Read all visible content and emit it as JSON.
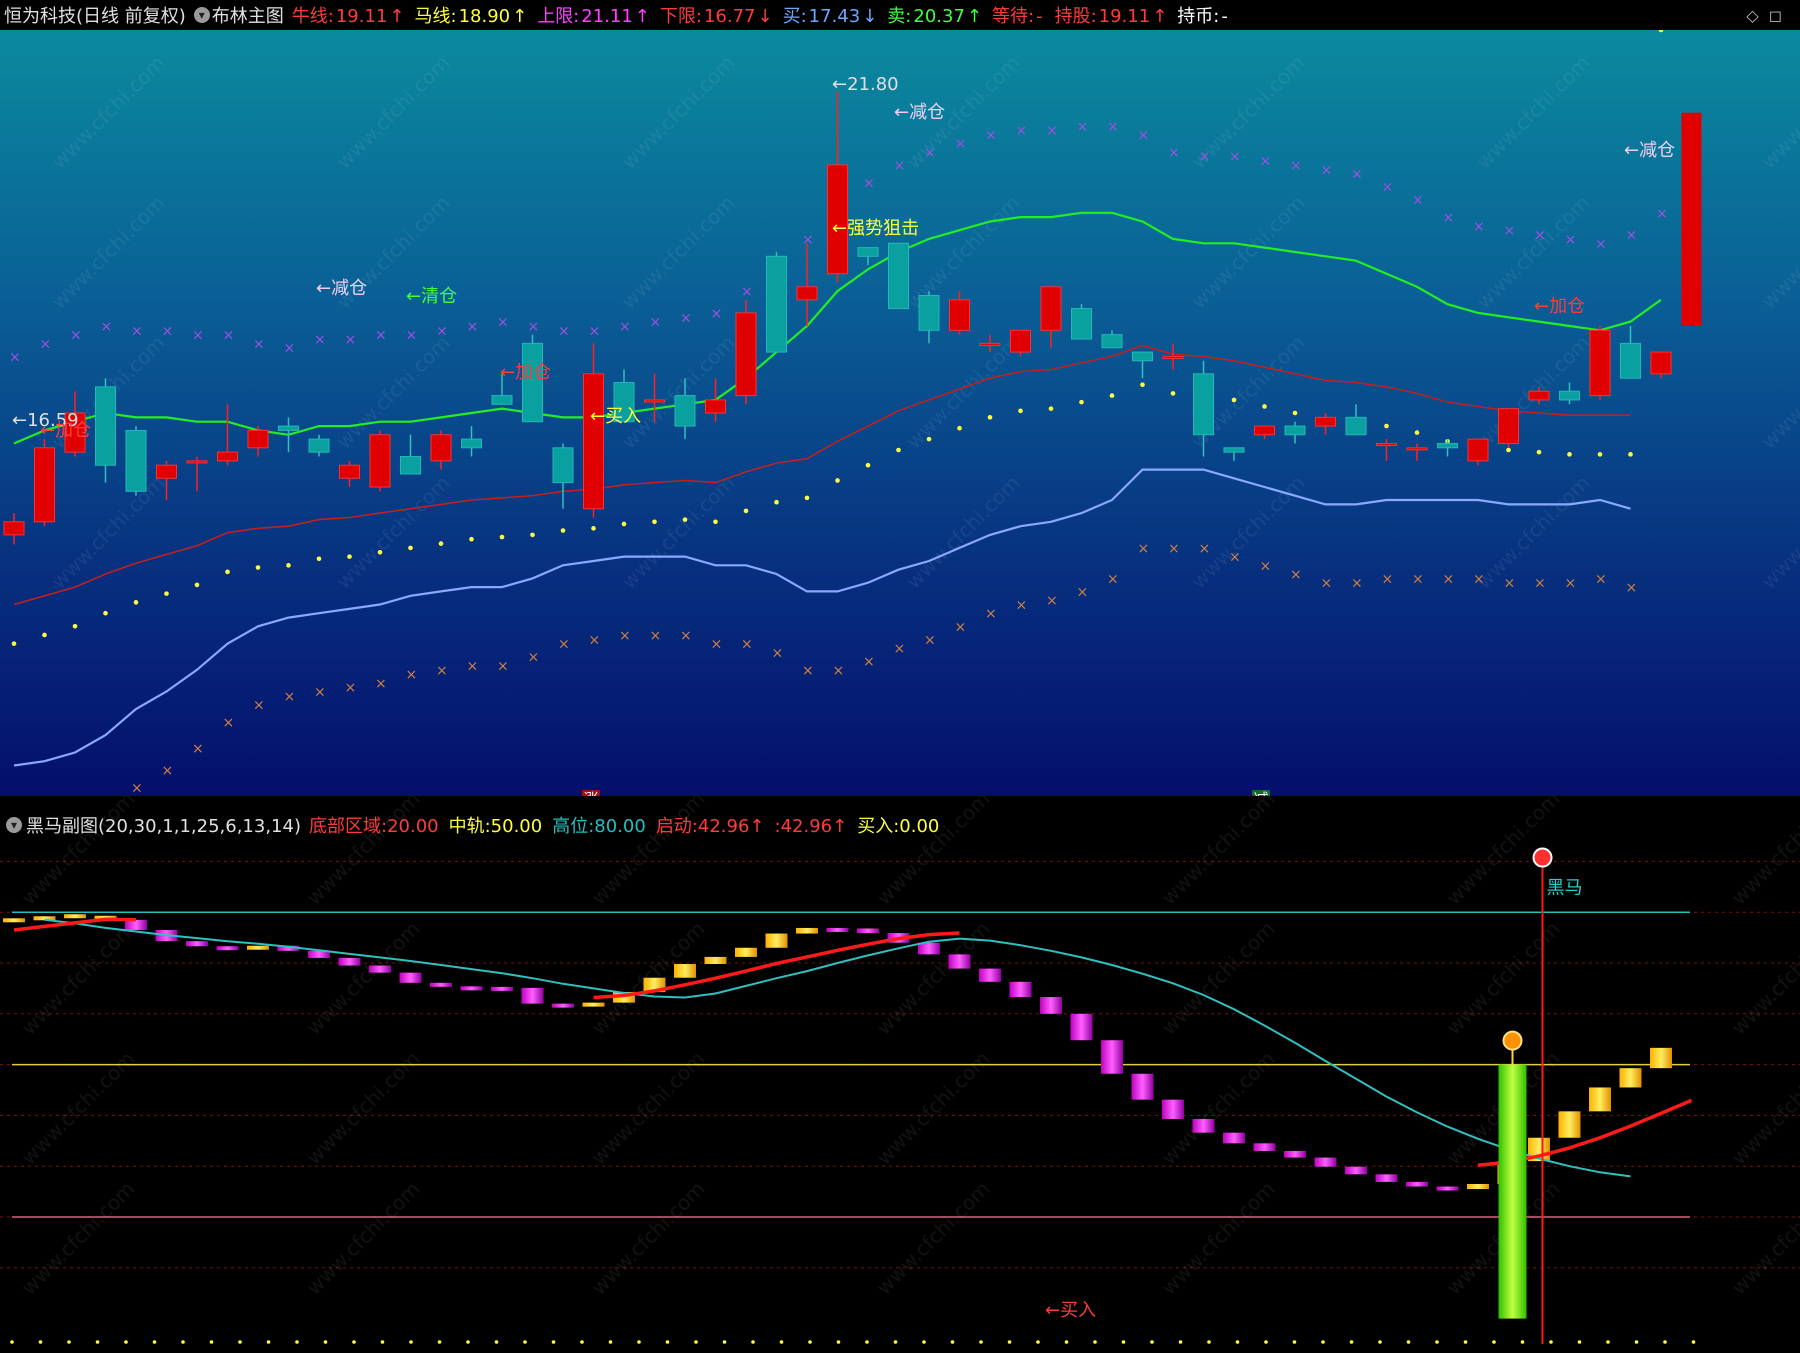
{
  "header": {
    "stock": "恒为科技(日线 前复权)",
    "indicator": "布林主图",
    "items": [
      {
        "label": "牛线:",
        "value": "19.11",
        "arrow": "↑",
        "label_color": "#ff3b3b",
        "value_color": "#ff3b3b"
      },
      {
        "label": "马线:",
        "value": "18.90",
        "arrow": "↑",
        "label_color": "#ffff40",
        "value_color": "#ffff40"
      },
      {
        "label": "上限:",
        "value": "21.11",
        "arrow": "↑",
        "label_color": "#ff40ff",
        "value_color": "#ff40ff"
      },
      {
        "label": "下限:",
        "value": "16.77",
        "arrow": "↓",
        "label_color": "#ff3b3b",
        "value_color": "#ff3b3b"
      },
      {
        "label": "买:",
        "value": "17.43",
        "arrow": "↓",
        "label_color": "#6aa8ff",
        "value_color": "#6aa8ff"
      },
      {
        "label": "卖:",
        "value": "20.37",
        "arrow": "↑",
        "label_color": "#40ff40",
        "value_color": "#40ff40"
      },
      {
        "label": "等待:",
        "value": "-",
        "arrow": "",
        "label_color": "#ff3b3b",
        "value_color": "#ff3b3b"
      },
      {
        "label": "持股:",
        "value": "19.11",
        "arrow": "↑",
        "label_color": "#ff3b3b",
        "value_color": "#ff3b3b"
      },
      {
        "label": "持币:",
        "value": "-",
        "arrow": "",
        "label_color": "#ffffff",
        "value_color": "#ffffff"
      }
    ]
  },
  "divider": {
    "rise_label": "涨",
    "cut_label": "减"
  },
  "sub_header": {
    "name": "黑马副图(20,30,1,1,25,6,13,14)",
    "items": [
      {
        "label": "底部区域:",
        "value": "20.00",
        "arrow": "",
        "color": "#ff3b3b"
      },
      {
        "label": "中轨:",
        "value": "50.00",
        "arrow": "",
        "color": "#ffff40"
      },
      {
        "label": "高位:",
        "value": "80.00",
        "arrow": "",
        "color": "#20c0c0"
      },
      {
        "label": "启动:",
        "value": "42.96",
        "arrow": "↑",
        "color": "#ff3b3b"
      },
      {
        "label": ":",
        "value": "42.96",
        "arrow": "↑",
        "color": "#ff3b3b"
      },
      {
        "label": "买入:",
        "value": "0.00",
        "arrow": "",
        "color": "#ffff40"
      }
    ]
  },
  "annotations_main": [
    {
      "text": "←16.59",
      "color": "#e0e0e0"
    },
    {
      "text": "←加仓",
      "color": "#ff3b3b"
    },
    {
      "text": "←减仓",
      "color": "#f0d0f0"
    },
    {
      "text": "←清仓",
      "color": "#40ff40"
    },
    {
      "text": "←加仓",
      "color": "#ff3b3b"
    },
    {
      "text": "←买入",
      "color": "#ffff40"
    },
    {
      "text": "←21.80",
      "color": "#e0e0e0"
    },
    {
      "text": "←减仓",
      "color": "#f0d0f0"
    },
    {
      "text": "←强势狙击",
      "color": "#ffff40"
    },
    {
      "text": "←加仓",
      "color": "#ff3b3b"
    },
    {
      "text": "←减仓",
      "color": "#f0d0f0"
    }
  ],
  "annotations_sub": [
    {
      "text": "黑马",
      "color": "#20d0d0"
    },
    {
      "text": "←买入",
      "color": "#ff3b3b"
    }
  ],
  "chart_data": [
    {
      "type": "candlestick",
      "title": "布林主图",
      "x": [
        1,
        2,
        3,
        4,
        5,
        6,
        7,
        8,
        9,
        10,
        11,
        12,
        13,
        14,
        15,
        16,
        17,
        18,
        19,
        20,
        21,
        22,
        23,
        24,
        25,
        26,
        27,
        28,
        29,
        30,
        31,
        32,
        33,
        34,
        35,
        36,
        37,
        38,
        39,
        40,
        41,
        42,
        43,
        44,
        45,
        46,
        47,
        48,
        49,
        50,
        51,
        52,
        53,
        54,
        55
      ],
      "ohlc": [
        [
          16.7,
          16.95,
          16.59,
          16.85
        ],
        [
          16.85,
          17.8,
          16.8,
          17.7
        ],
        [
          17.65,
          18.35,
          17.6,
          18.1
        ],
        [
          18.4,
          18.5,
          17.3,
          17.5
        ],
        [
          17.9,
          17.95,
          17.15,
          17.2
        ],
        [
          17.35,
          17.55,
          17.1,
          17.5
        ],
        [
          17.55,
          17.6,
          17.2,
          17.55
        ],
        [
          17.55,
          18.2,
          17.5,
          17.65
        ],
        [
          17.7,
          17.95,
          17.6,
          17.9
        ],
        [
          17.95,
          18.05,
          17.65,
          17.9
        ],
        [
          17.8,
          17.85,
          17.6,
          17.65
        ],
        [
          17.35,
          17.55,
          17.25,
          17.5
        ],
        [
          17.25,
          17.9,
          17.2,
          17.85
        ],
        [
          17.6,
          17.85,
          17.4,
          17.4
        ],
        [
          17.55,
          17.9,
          17.45,
          17.85
        ],
        [
          17.8,
          17.95,
          17.6,
          17.7
        ],
        [
          18.3,
          18.55,
          18.3,
          18.2
        ],
        [
          18.9,
          19.0,
          18.0,
          18.0
        ],
        [
          17.7,
          17.75,
          17.0,
          17.3
        ],
        [
          17.0,
          18.9,
          16.9,
          18.55
        ],
        [
          18.45,
          18.6,
          18.0,
          18.0
        ],
        [
          18.25,
          18.55,
          18.0,
          18.25
        ],
        [
          18.3,
          18.5,
          17.8,
          17.95
        ],
        [
          18.1,
          18.5,
          18.0,
          18.25
        ],
        [
          18.3,
          19.4,
          18.2,
          19.25
        ],
        [
          19.9,
          19.95,
          18.8,
          18.8
        ],
        [
          19.4,
          20.05,
          19.1,
          19.55
        ],
        [
          19.7,
          21.8,
          19.6,
          20.95
        ],
        [
          20.0,
          20.0,
          19.8,
          19.9
        ],
        [
          20.05,
          20.05,
          19.3,
          19.3
        ],
        [
          19.45,
          19.5,
          18.9,
          19.05
        ],
        [
          19.05,
          19.5,
          19.0,
          19.4
        ],
        [
          18.9,
          19.0,
          18.8,
          18.9
        ],
        [
          18.8,
          19.0,
          18.75,
          19.05
        ],
        [
          19.05,
          19.55,
          18.85,
          19.55
        ],
        [
          19.3,
          19.35,
          18.95,
          18.95
        ],
        [
          19.0,
          19.05,
          18.85,
          18.85
        ],
        [
          18.8,
          18.8,
          18.5,
          18.7
        ],
        [
          18.75,
          18.9,
          18.6,
          18.75
        ],
        [
          18.55,
          18.7,
          17.6,
          17.85
        ],
        [
          17.7,
          17.7,
          17.55,
          17.65
        ],
        [
          17.85,
          17.95,
          17.8,
          17.95
        ],
        [
          17.95,
          18.0,
          17.75,
          17.85
        ],
        [
          17.95,
          18.1,
          17.85,
          18.05
        ],
        [
          18.05,
          18.2,
          17.95,
          17.85
        ],
        [
          17.75,
          17.8,
          17.55,
          17.75
        ],
        [
          17.7,
          17.75,
          17.55,
          17.7
        ],
        [
          17.75,
          17.8,
          17.6,
          17.7
        ],
        [
          17.55,
          17.8,
          17.5,
          17.8
        ],
        [
          17.75,
          18.1,
          17.7,
          18.15
        ],
        [
          18.25,
          18.4,
          18.2,
          18.35
        ],
        [
          18.35,
          18.45,
          18.2,
          18.25
        ],
        [
          18.3,
          19.1,
          18.25,
          19.05
        ],
        [
          18.9,
          19.1,
          18.5,
          18.5
        ],
        [
          18.55,
          18.8,
          18.5,
          18.8
        ]
      ],
      "last_close": 20.25,
      "upper_band": [
        17.75,
        17.9,
        18.0,
        18.1,
        18.05,
        18.05,
        18.0,
        18.0,
        17.9,
        17.85,
        17.95,
        17.95,
        18.0,
        18.0,
        18.05,
        18.1,
        18.15,
        18.1,
        18.05,
        18.05,
        18.1,
        18.15,
        18.2,
        18.25,
        18.5,
        18.8,
        19.1,
        19.5,
        19.75,
        19.95,
        20.1,
        20.2,
        20.3,
        20.35,
        20.35,
        20.4,
        20.4,
        20.3,
        20.1,
        20.05,
        20.05,
        20.0,
        19.95,
        19.9,
        19.85,
        19.7,
        19.55,
        19.35,
        19.25,
        19.2,
        19.15,
        19.1,
        19.05,
        19.15,
        19.4
      ],
      "lower_band": [
        14.05,
        14.1,
        14.2,
        14.4,
        14.7,
        14.9,
        15.15,
        15.45,
        15.65,
        15.75,
        15.8,
        15.85,
        15.9,
        16.0,
        16.05,
        16.1,
        16.1,
        16.2,
        16.35,
        16.4,
        16.45,
        16.45,
        16.45,
        16.35,
        16.35,
        16.25,
        16.05,
        16.05,
        16.15,
        16.3,
        16.4,
        16.55,
        16.7,
        16.8,
        16.85,
        16.95,
        17.1,
        17.45,
        17.45,
        17.45,
        17.35,
        17.25,
        17.15,
        17.05,
        17.05,
        17.1,
        17.1,
        17.1,
        17.1,
        17.05,
        17.05,
        17.05,
        17.1,
        17.0
      ],
      "ylim": [
        13.7,
        22.5
      ]
    },
    {
      "type": "bar-line",
      "title": "黑马副图",
      "reference_lines": {
        "底部区域": 20,
        "中轨": 50,
        "高位": 80
      },
      "grid": "dotted",
      "x": [
        1,
        2,
        3,
        4,
        5,
        6,
        7,
        8,
        9,
        10,
        11,
        12,
        13,
        14,
        15,
        16,
        17,
        18,
        19,
        20,
        21,
        22,
        23,
        24,
        25,
        26,
        27,
        28,
        29,
        30,
        31,
        32,
        33,
        34,
        35,
        36,
        37,
        38,
        39,
        40,
        41,
        42,
        43,
        44,
        45,
        46,
        47,
        48,
        49,
        50,
        51,
        52,
        53,
        54,
        55
      ],
      "bars_open": [
        78.5,
        78.8,
        79.2,
        79.3,
        78.5,
        76.5,
        74.3,
        73.3,
        73.1,
        73.4,
        72.4,
        71.0,
        69.5,
        68.1,
        66.1,
        65.4,
        65.3,
        65.1,
        62.0,
        61.5,
        62.2,
        64.3,
        67.1,
        69.8,
        71.2,
        73.0,
        75.8,
        76.9,
        76.8,
        75.9,
        74.0,
        71.7,
        68.9,
        66.3,
        63.3,
        60.0,
        54.8,
        48.2,
        43.1,
        39.3,
        36.6,
        34.5,
        33.0,
        31.7,
        29.9,
        28.4,
        26.9,
        26.0,
        25.5,
        26.5,
        31.0,
        35.6,
        40.8,
        45.5,
        49.3
      ],
      "bars_close": [
        78.8,
        79.2,
        79.6,
        79.3,
        76.5,
        74.3,
        73.3,
        73.1,
        73.4,
        72.4,
        71.0,
        69.5,
        68.1,
        66.1,
        65.4,
        65.3,
        65.1,
        62.0,
        61.5,
        62.2,
        64.3,
        67.1,
        69.8,
        71.2,
        73.0,
        75.8,
        76.9,
        76.8,
        75.9,
        74.0,
        71.7,
        68.9,
        66.3,
        63.3,
        60.0,
        54.8,
        48.2,
        43.1,
        39.3,
        36.6,
        34.5,
        33.0,
        31.7,
        29.9,
        28.4,
        26.9,
        26.0,
        25.5,
        26.5,
        31.0,
        35.6,
        40.8,
        45.5,
        49.3,
        53.3
      ],
      "bull_line": [
        76.5,
        77.2,
        77.9,
        78.6,
        78.5
      ],
      "bull_line_2": [
        63.2,
        63.6,
        64.5,
        65.7,
        67.0,
        68.4,
        69.9,
        71.2,
        72.5,
        73.7,
        74.8,
        75.6,
        75.9
      ],
      "bull_line_3": [
        30.2,
        30.8,
        32.0,
        33.6,
        35.6,
        37.9,
        40.4,
        42.96
      ],
      "signal_line": [
        78.5,
        77.8,
        76.9,
        76.2,
        75.5,
        74.9,
        74.3,
        73.8,
        73.2,
        72.5,
        71.8,
        71.1,
        70.4,
        69.6,
        68.8,
        68.0,
        67.0,
        65.9,
        65.0,
        64.1,
        63.4,
        63.2,
        64.0,
        65.5,
        67.0,
        68.4,
        70.0,
        71.5,
        72.9,
        74.2,
        74.8,
        74.4,
        73.5,
        72.4,
        71.1,
        69.6,
        67.9,
        66.0,
        63.7,
        60.9,
        57.7,
        54.3,
        50.7,
        47.2,
        43.7,
        40.6,
        37.8,
        35.4,
        33.3,
        31.5,
        30.0,
        28.8,
        28.0
      ],
      "black_horse_bar": {
        "x": 50,
        "from": 0,
        "to": 50
      },
      "ylim": [
        -5,
        95
      ]
    }
  ]
}
